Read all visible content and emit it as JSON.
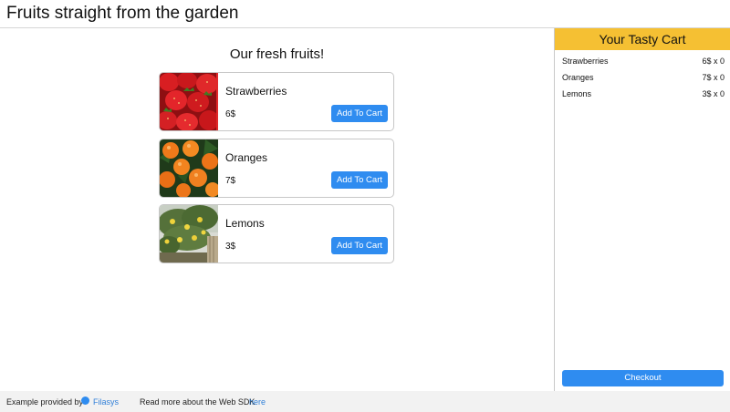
{
  "header": {
    "title": "Fruits straight from the garden"
  },
  "main": {
    "section_title": "Our fresh fruits!"
  },
  "products": [
    {
      "name": "Strawberries",
      "price": "6$",
      "button_label": "Add To Cart",
      "image_icon": "strawberry-photo"
    },
    {
      "name": "Oranges",
      "price": "7$",
      "button_label": "Add To Cart",
      "image_icon": "orange-photo"
    },
    {
      "name": "Lemons",
      "price": "3$",
      "button_label": "Add To Cart",
      "image_icon": "lemon-tree-photo"
    }
  ],
  "cart": {
    "title": "Your Tasty Cart",
    "items": [
      {
        "name": "Strawberries",
        "qty": "6$ x 0"
      },
      {
        "name": "Oranges",
        "qty": "7$ x 0"
      },
      {
        "name": "Lemons",
        "qty": "3$ x 0"
      }
    ],
    "checkout_label": "Checkout"
  },
  "footer": {
    "provided_text": "Example provided by",
    "brand": "Filasys",
    "read_more_text": "Read more about the Web SDK",
    "link_text": "here"
  },
  "colors": {
    "accent": "#2f8cf0",
    "cart_header": "#f5c033",
    "link": "#2f7fd8"
  }
}
